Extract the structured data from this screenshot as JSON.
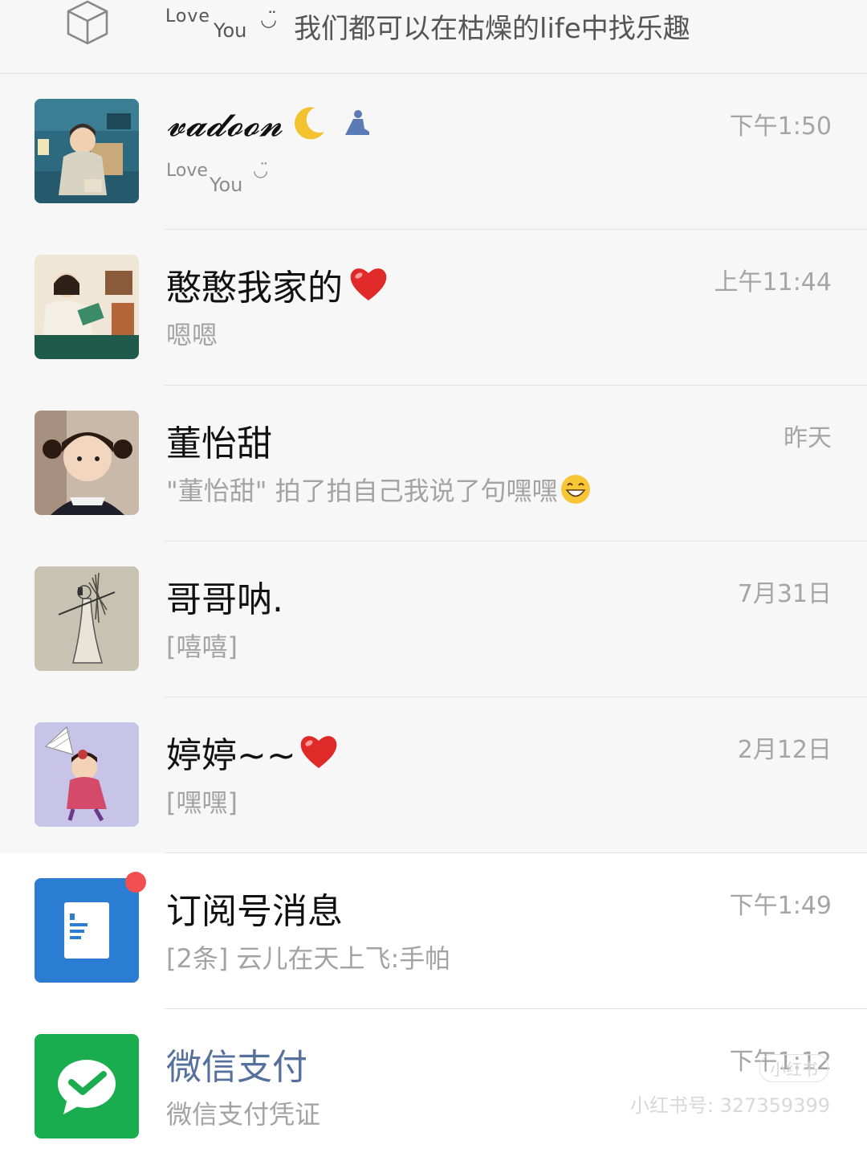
{
  "top_bar": {
    "icon": "cube-icon",
    "love": "Love",
    "you": "You",
    "smile": "◡̈",
    "status_text": "我们都可以在枯燥的life中找乐趣"
  },
  "chats": [
    {
      "name": "𝓿𝓪𝓭𝓸𝓸𝓷",
      "name_decoration": [
        "crescent-moon-icon",
        "person-kneeling-icon"
      ],
      "preview_love": "Love",
      "preview_you": "You",
      "preview_smile": "◡̈",
      "time": "下午1:50"
    },
    {
      "name": "憨憨我家的",
      "name_decoration": [
        "red-heart-icon"
      ],
      "preview": "嗯嗯",
      "time": "上午11:44"
    },
    {
      "name": "董怡甜",
      "preview": "\"董怡甜\" 拍了拍自己我说了句嘿嘿",
      "preview_emoji": "grinning-face-icon",
      "time": "昨天"
    },
    {
      "name": "哥哥呐.",
      "preview": "[嘻嘻]",
      "time": "7月31日"
    },
    {
      "name": "婷婷~~",
      "name_decoration": [
        "red-heart-icon"
      ],
      "preview": "[嘿嘿]",
      "time": "2月12日"
    },
    {
      "name": "订阅号消息",
      "preview": "[2条] 云儿在天上飞:手帕",
      "time": "下午1:49",
      "unread_dot": true
    },
    {
      "name": "微信支付",
      "preview": "微信支付凭证",
      "time": "下午1:12"
    }
  ],
  "watermark": {
    "badge": "小红书",
    "text": "小红书号: 327359399"
  },
  "colors": {
    "background": "#f7f7f7",
    "subscription_blue": "#2b7cd3",
    "wechat_pay_green": "#1aad4f",
    "unread_red": "#f25050",
    "pay_name_blue": "#55709c"
  }
}
